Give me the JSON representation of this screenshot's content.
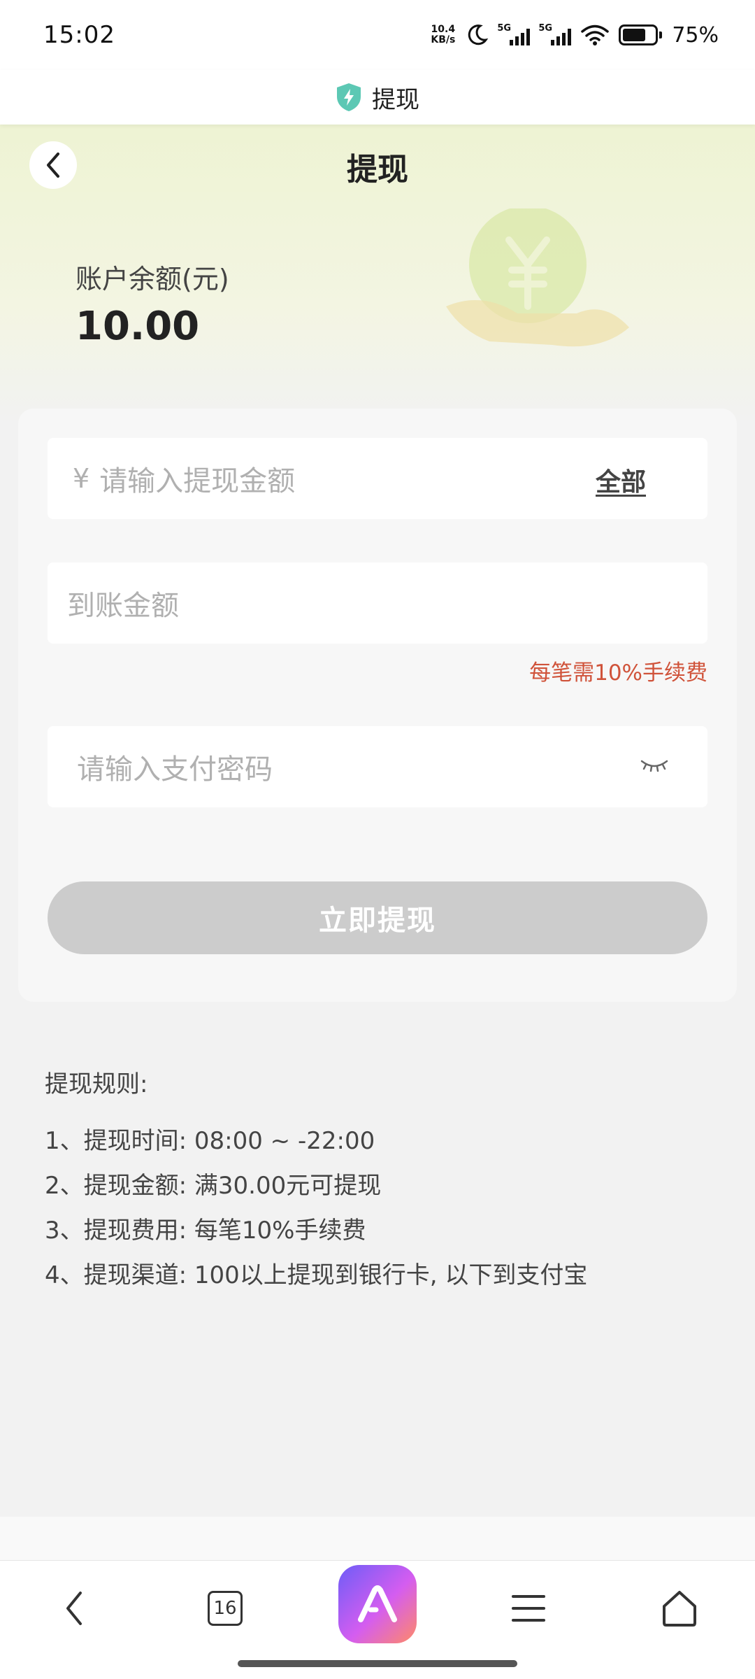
{
  "status_bar": {
    "time": "15:02",
    "net_speed_value": "10.4",
    "net_speed_unit": "KB/s",
    "network_1": "5G",
    "network_2": "5G",
    "battery_percent": "75%"
  },
  "browser": {
    "title": "提现",
    "shield_color": "#5cc8b4"
  },
  "header": {
    "title": "提现",
    "balance_label": "账户余额(元)",
    "balance_value": "10.00"
  },
  "form": {
    "amount_currency": "¥",
    "amount_placeholder": "请输入提现金额",
    "all_label": "全部",
    "arrive_placeholder": "到账金额",
    "fee_note": "每笔需10%手续费",
    "password_placeholder": "请输入支付密码",
    "submit_label": "立即提现"
  },
  "rules": {
    "title": "提现规则:",
    "items": [
      "1、提现时间: 08:00 ~ -22:00",
      "2、提现金额: 满30.00元可提现",
      "3、提现费用: 每笔10%手续费",
      "4、提现渠道: 100以上提现到银行卡, 以下到支付宝"
    ]
  },
  "bottom_nav": {
    "tab_count": "16"
  },
  "colors": {
    "accent_fee": "#d0533a",
    "button_disabled": "#cccccc",
    "header_green": "#eef3d3"
  }
}
